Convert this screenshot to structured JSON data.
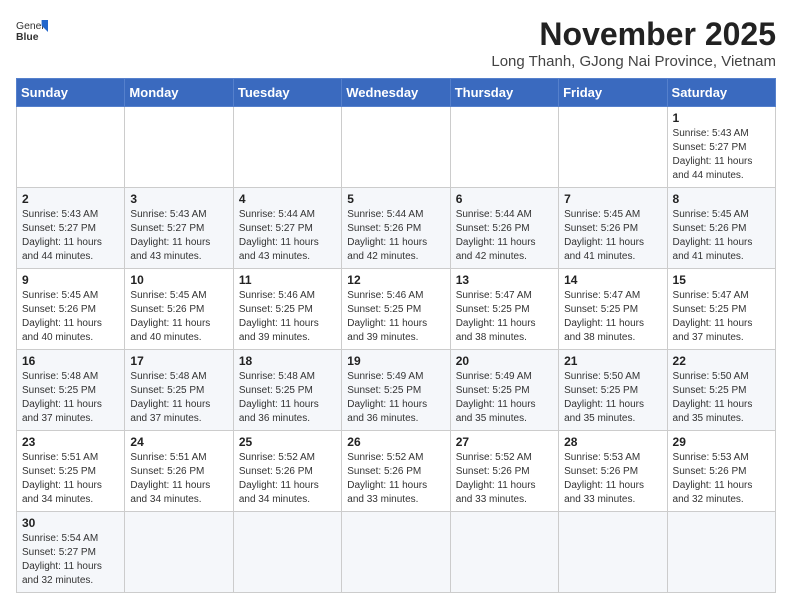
{
  "logo": {
    "line1": "General",
    "line2": "Blue"
  },
  "header": {
    "month_title": "November 2025",
    "location": "Long Thanh, GJong Nai Province, Vietnam"
  },
  "weekdays": [
    "Sunday",
    "Monday",
    "Tuesday",
    "Wednesday",
    "Thursday",
    "Friday",
    "Saturday"
  ],
  "weeks": [
    [
      {
        "date": "",
        "info": ""
      },
      {
        "date": "",
        "info": ""
      },
      {
        "date": "",
        "info": ""
      },
      {
        "date": "",
        "info": ""
      },
      {
        "date": "",
        "info": ""
      },
      {
        "date": "",
        "info": ""
      },
      {
        "date": "1",
        "info": "Sunrise: 5:43 AM\nSunset: 5:27 PM\nDaylight: 11 hours and 44 minutes."
      }
    ],
    [
      {
        "date": "2",
        "info": "Sunrise: 5:43 AM\nSunset: 5:27 PM\nDaylight: 11 hours and 44 minutes."
      },
      {
        "date": "3",
        "info": "Sunrise: 5:43 AM\nSunset: 5:27 PM\nDaylight: 11 hours and 43 minutes."
      },
      {
        "date": "4",
        "info": "Sunrise: 5:44 AM\nSunset: 5:27 PM\nDaylight: 11 hours and 43 minutes."
      },
      {
        "date": "5",
        "info": "Sunrise: 5:44 AM\nSunset: 5:26 PM\nDaylight: 11 hours and 42 minutes."
      },
      {
        "date": "6",
        "info": "Sunrise: 5:44 AM\nSunset: 5:26 PM\nDaylight: 11 hours and 42 minutes."
      },
      {
        "date": "7",
        "info": "Sunrise: 5:45 AM\nSunset: 5:26 PM\nDaylight: 11 hours and 41 minutes."
      },
      {
        "date": "8",
        "info": "Sunrise: 5:45 AM\nSunset: 5:26 PM\nDaylight: 11 hours and 41 minutes."
      }
    ],
    [
      {
        "date": "9",
        "info": "Sunrise: 5:45 AM\nSunset: 5:26 PM\nDaylight: 11 hours and 40 minutes."
      },
      {
        "date": "10",
        "info": "Sunrise: 5:45 AM\nSunset: 5:26 PM\nDaylight: 11 hours and 40 minutes."
      },
      {
        "date": "11",
        "info": "Sunrise: 5:46 AM\nSunset: 5:25 PM\nDaylight: 11 hours and 39 minutes."
      },
      {
        "date": "12",
        "info": "Sunrise: 5:46 AM\nSunset: 5:25 PM\nDaylight: 11 hours and 39 minutes."
      },
      {
        "date": "13",
        "info": "Sunrise: 5:47 AM\nSunset: 5:25 PM\nDaylight: 11 hours and 38 minutes."
      },
      {
        "date": "14",
        "info": "Sunrise: 5:47 AM\nSunset: 5:25 PM\nDaylight: 11 hours and 38 minutes."
      },
      {
        "date": "15",
        "info": "Sunrise: 5:47 AM\nSunset: 5:25 PM\nDaylight: 11 hours and 37 minutes."
      }
    ],
    [
      {
        "date": "16",
        "info": "Sunrise: 5:48 AM\nSunset: 5:25 PM\nDaylight: 11 hours and 37 minutes."
      },
      {
        "date": "17",
        "info": "Sunrise: 5:48 AM\nSunset: 5:25 PM\nDaylight: 11 hours and 37 minutes."
      },
      {
        "date": "18",
        "info": "Sunrise: 5:48 AM\nSunset: 5:25 PM\nDaylight: 11 hours and 36 minutes."
      },
      {
        "date": "19",
        "info": "Sunrise: 5:49 AM\nSunset: 5:25 PM\nDaylight: 11 hours and 36 minutes."
      },
      {
        "date": "20",
        "info": "Sunrise: 5:49 AM\nSunset: 5:25 PM\nDaylight: 11 hours and 35 minutes."
      },
      {
        "date": "21",
        "info": "Sunrise: 5:50 AM\nSunset: 5:25 PM\nDaylight: 11 hours and 35 minutes."
      },
      {
        "date": "22",
        "info": "Sunrise: 5:50 AM\nSunset: 5:25 PM\nDaylight: 11 hours and 35 minutes."
      }
    ],
    [
      {
        "date": "23",
        "info": "Sunrise: 5:51 AM\nSunset: 5:25 PM\nDaylight: 11 hours and 34 minutes."
      },
      {
        "date": "24",
        "info": "Sunrise: 5:51 AM\nSunset: 5:26 PM\nDaylight: 11 hours and 34 minutes."
      },
      {
        "date": "25",
        "info": "Sunrise: 5:52 AM\nSunset: 5:26 PM\nDaylight: 11 hours and 34 minutes."
      },
      {
        "date": "26",
        "info": "Sunrise: 5:52 AM\nSunset: 5:26 PM\nDaylight: 11 hours and 33 minutes."
      },
      {
        "date": "27",
        "info": "Sunrise: 5:52 AM\nSunset: 5:26 PM\nDaylight: 11 hours and 33 minutes."
      },
      {
        "date": "28",
        "info": "Sunrise: 5:53 AM\nSunset: 5:26 PM\nDaylight: 11 hours and 33 minutes."
      },
      {
        "date": "29",
        "info": "Sunrise: 5:53 AM\nSunset: 5:26 PM\nDaylight: 11 hours and 32 minutes."
      }
    ],
    [
      {
        "date": "30",
        "info": "Sunrise: 5:54 AM\nSunset: 5:27 PM\nDaylight: 11 hours and 32 minutes."
      },
      {
        "date": "",
        "info": ""
      },
      {
        "date": "",
        "info": ""
      },
      {
        "date": "",
        "info": ""
      },
      {
        "date": "",
        "info": ""
      },
      {
        "date": "",
        "info": ""
      },
      {
        "date": "",
        "info": ""
      }
    ]
  ]
}
